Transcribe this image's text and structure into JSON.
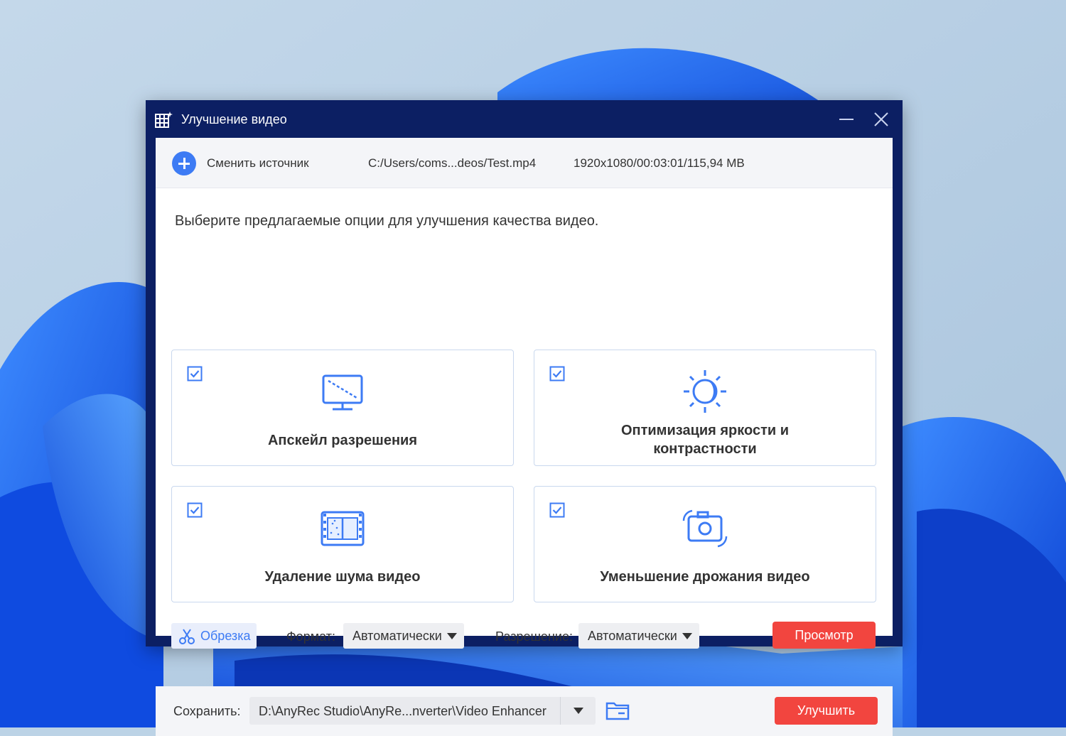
{
  "window": {
    "title": "Улучшение видео",
    "app_icon": "video-enhance-icon"
  },
  "source": {
    "change_label": "Сменить источник",
    "file_path": "C:/Users/coms...deos/Test.mp4",
    "file_meta": "1920x1080/00:03:01/115,94 MB"
  },
  "instructions": "Выберите предлагаемые опции для улучшения качества видео.",
  "options": [
    {
      "label": "Апскейл разрешения",
      "checked": true,
      "icon": "upscale-monitor-icon"
    },
    {
      "label_line1": "Оптимизация яркости и",
      "label_line2": "контрастности",
      "checked": true,
      "icon": "brightness-icon"
    },
    {
      "label": "Удаление шума видео",
      "checked": true,
      "icon": "denoise-film-icon"
    },
    {
      "label": "Уменьшение дрожания видео",
      "checked": true,
      "icon": "stabilize-camera-icon"
    }
  ],
  "controls": {
    "trim_label": "Обрезка",
    "format_label": "Формат:",
    "format_value": "Автоматически",
    "resolution_label": "Разрешение:",
    "resolution_value": "Автоматически",
    "preview_label": "Просмотр"
  },
  "save": {
    "label": "Сохранить:",
    "path": "D:\\AnyRec Studio\\AnyRe...nverter\\Video Enhancer",
    "enhance_label": "Улучшить"
  },
  "colors": {
    "accent": "#3d7bf4",
    "titlebar": "#0c1f63",
    "primary_button": "#f2453f"
  }
}
